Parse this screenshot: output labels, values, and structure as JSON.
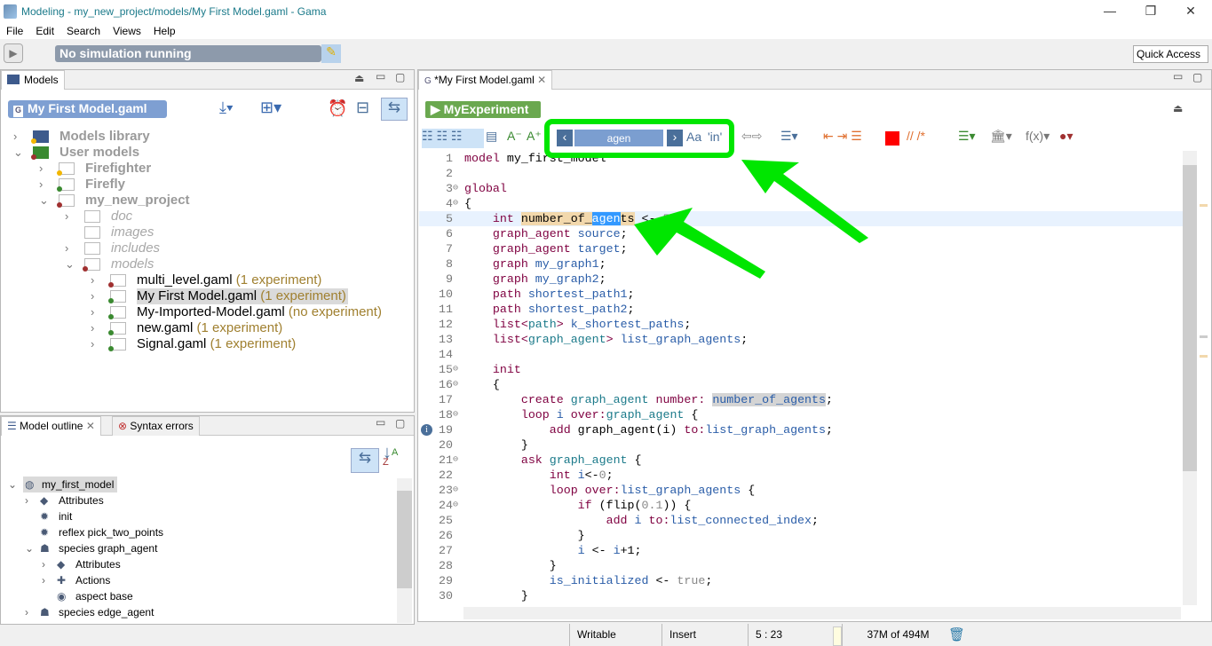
{
  "window": {
    "title": "Modeling - my_new_project/models/My First Model.gaml - Gama",
    "controls": [
      "—",
      "❐",
      "✕"
    ]
  },
  "menu": [
    "File",
    "Edit",
    "Search",
    "Views",
    "Help"
  ],
  "toolbar": {
    "status": "No simulation running",
    "quick_access": "Quick Access"
  },
  "models_panel": {
    "tab": "Models",
    "selected_file": "My First Model.gaml",
    "tree": [
      {
        "label": "Models library",
        "level": 0,
        "style": "grey",
        "chevron": "›",
        "dot": "#f2b600"
      },
      {
        "label": "User models",
        "level": 0,
        "style": "grey",
        "chevron": "⌄",
        "dot": "#a03030"
      },
      {
        "label": "Firefighter",
        "level": 1,
        "style": "grey",
        "chevron": "›",
        "dot": "#f2b600"
      },
      {
        "label": "Firefly",
        "level": 1,
        "style": "grey",
        "chevron": "›",
        "dot": "#3a8a30"
      },
      {
        "label": "my_new_project",
        "level": 1,
        "style": "grey",
        "chevron": "⌄",
        "dot": "#a03030"
      },
      {
        "label": "doc",
        "level": 2,
        "style": "ital",
        "chevron": "›"
      },
      {
        "label": "images",
        "level": 2,
        "style": "ital",
        "chevron": ""
      },
      {
        "label": "includes",
        "level": 2,
        "style": "ital",
        "chevron": "›"
      },
      {
        "label": "models",
        "level": 2,
        "style": "ital",
        "chevron": "⌄",
        "dot": "#a03030"
      },
      {
        "label": "multi_level.gaml",
        "extra": "(1 experiment)",
        "level": 3,
        "chevron": "›",
        "dot": "#a03030"
      },
      {
        "label": "My First Model.gaml",
        "extra": "(1 experiment)",
        "level": 3,
        "chevron": "›",
        "dot": "#3a8a30",
        "selected": true
      },
      {
        "label": "My-Imported-Model.gaml",
        "extra": "(no experiment)",
        "level": 3,
        "chevron": "›",
        "dot": "#3a8a30"
      },
      {
        "label": "new.gaml",
        "extra": "(1 experiment)",
        "level": 3,
        "chevron": "›",
        "dot": "#3a8a30"
      },
      {
        "label": "Signal.gaml",
        "extra": "(1 experiment)",
        "level": 3,
        "chevron": "›",
        "dot": "#3a8a30"
      }
    ]
  },
  "outline_panel": {
    "tabs": [
      "Model outline",
      "Syntax errors"
    ],
    "tree": [
      {
        "label": "my_first_model",
        "level": 0,
        "chevron": "⌄",
        "icon": "globe-icon",
        "glyph": "◍",
        "selected": true
      },
      {
        "label": "Attributes",
        "level": 1,
        "chevron": "›",
        "icon": "tag-icon",
        "glyph": "◆"
      },
      {
        "label": "init",
        "level": 1,
        "chevron": "",
        "icon": "gear-icon",
        "glyph": "✹"
      },
      {
        "label": "reflex pick_two_points",
        "level": 1,
        "chevron": "",
        "icon": "gear-icon",
        "glyph": "✹"
      },
      {
        "label": "species graph_agent",
        "level": 1,
        "chevron": "⌄",
        "icon": "person-icon",
        "glyph": "☗"
      },
      {
        "label": "Attributes",
        "level": 2,
        "chevron": "›",
        "icon": "tag-icon",
        "glyph": "◆"
      },
      {
        "label": "Actions",
        "level": 2,
        "chevron": "›",
        "icon": "puzzle-icon",
        "glyph": "✚"
      },
      {
        "label": "aspect base",
        "level": 2,
        "chevron": "",
        "icon": "eye-icon",
        "glyph": "◉"
      },
      {
        "label": "species edge_agent",
        "level": 1,
        "chevron": "›",
        "icon": "person-icon",
        "glyph": "☗"
      }
    ]
  },
  "editor": {
    "tab": "*My First Model.gaml",
    "experiment": "MyExperiment",
    "search": {
      "value": "agen",
      "case_label": "Aa",
      "word_label": "'in'"
    },
    "code": [
      [
        [
          "model",
          "k"
        ],
        [
          " my_first_model",
          "p"
        ]
      ],
      [],
      [
        [
          "global",
          "k"
        ]
      ],
      [
        [
          "{",
          "p"
        ]
      ],
      [
        [
          "    ",
          "p"
        ],
        [
          "int",
          "k"
        ],
        [
          " ",
          "p"
        ],
        [
          "number_of_",
          "h"
        ],
        [
          "agen",
          "s"
        ],
        [
          "ts",
          "h"
        ],
        [
          " <- ",
          "p"
        ],
        [
          "50",
          "n"
        ],
        [
          ";",
          "p"
        ]
      ],
      [
        [
          "    graph_agent",
          "k"
        ],
        [
          " source",
          "v"
        ],
        [
          ";",
          "p"
        ]
      ],
      [
        [
          "    graph_agent",
          "k"
        ],
        [
          " target",
          "v"
        ],
        [
          ";",
          "p"
        ]
      ],
      [
        [
          "    graph",
          "k"
        ],
        [
          " my_graph1",
          "v"
        ],
        [
          ";",
          "p"
        ]
      ],
      [
        [
          "    graph",
          "k"
        ],
        [
          " my_graph2",
          "v"
        ],
        [
          ";",
          "p"
        ]
      ],
      [
        [
          "    path",
          "k"
        ],
        [
          " shortest_path1",
          "v"
        ],
        [
          ";",
          "p"
        ]
      ],
      [
        [
          "    path",
          "k"
        ],
        [
          " shortest_path2",
          "v"
        ],
        [
          ";",
          "p"
        ]
      ],
      [
        [
          "    list<",
          "k"
        ],
        [
          "path",
          "t"
        ],
        [
          "> ",
          "k"
        ],
        [
          "k_shortest_paths",
          "v"
        ],
        [
          ";",
          "p"
        ]
      ],
      [
        [
          "    list<",
          "k"
        ],
        [
          "graph_agent",
          "t"
        ],
        [
          "> ",
          "k"
        ],
        [
          "list_graph_agents",
          "v"
        ],
        [
          ";",
          "p"
        ]
      ],
      [],
      [
        [
          "    init",
          "k"
        ]
      ],
      [
        [
          "    {",
          "p"
        ]
      ],
      [
        [
          "        create",
          "k"
        ],
        [
          " graph_agent",
          "t"
        ],
        [
          " number:",
          "k"
        ],
        [
          " ",
          "p"
        ],
        [
          "number_of_agents",
          "hv"
        ],
        [
          ";",
          "p"
        ]
      ],
      [
        [
          "        loop",
          "k"
        ],
        [
          " i",
          "v"
        ],
        [
          " over:",
          "k"
        ],
        [
          "graph_agent",
          "t"
        ],
        [
          " {",
          "p"
        ]
      ],
      [
        [
          "            add",
          "k"
        ],
        [
          " graph_agent(i)",
          "p"
        ],
        [
          " to:",
          "k"
        ],
        [
          "list_graph_agents",
          "v"
        ],
        [
          ";",
          "p"
        ]
      ],
      [
        [
          "        }",
          "p"
        ]
      ],
      [
        [
          "        ask",
          "k"
        ],
        [
          " graph_agent",
          "t"
        ],
        [
          " {",
          "p"
        ]
      ],
      [
        [
          "            int",
          "k"
        ],
        [
          " i",
          "v"
        ],
        [
          "<-",
          "p"
        ],
        [
          "0",
          "n"
        ],
        [
          ";",
          "p"
        ]
      ],
      [
        [
          "            loop",
          "k"
        ],
        [
          " over:",
          "k"
        ],
        [
          "list_graph_agents",
          "v"
        ],
        [
          " {",
          "p"
        ]
      ],
      [
        [
          "                if",
          "k"
        ],
        [
          " (flip(",
          "p"
        ],
        [
          "0.1",
          "n"
        ],
        [
          ")) {",
          "p"
        ]
      ],
      [
        [
          "                    add",
          "k"
        ],
        [
          " i",
          "v"
        ],
        [
          " to:",
          "k"
        ],
        [
          "list_connected_index",
          "v"
        ],
        [
          ";",
          "p"
        ]
      ],
      [
        [
          "                }",
          "p"
        ]
      ],
      [
        [
          "                i",
          "v"
        ],
        [
          " <- ",
          "p"
        ],
        [
          "i",
          "v"
        ],
        [
          "+1;",
          "p"
        ]
      ],
      [
        [
          "            }",
          "p"
        ]
      ],
      [
        [
          "            is_initialized",
          "v"
        ],
        [
          " <- ",
          "p"
        ],
        [
          "true",
          "n"
        ],
        [
          ";",
          "p"
        ]
      ],
      [
        [
          "        }",
          "p"
        ]
      ]
    ],
    "folding_lines": [
      3,
      4,
      15,
      16,
      18,
      21,
      23,
      24
    ],
    "info_marker_line": 19
  },
  "statusbar": {
    "mode": "Writable",
    "insert": "Insert",
    "position": "5 : 23",
    "memory": "37M of 494M"
  },
  "colors": {
    "accent_green": "#00e600",
    "experiment_green": "#6aa84f",
    "selection": "#3399ff",
    "occurrence": "#f2d8ac"
  }
}
